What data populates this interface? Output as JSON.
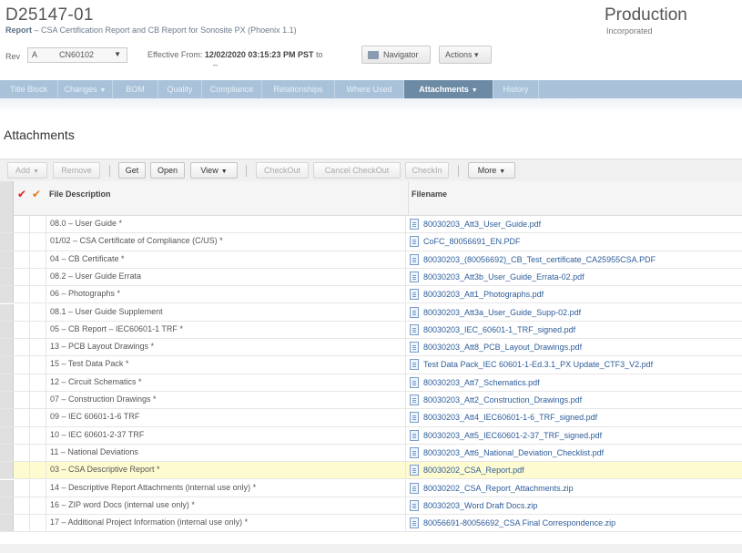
{
  "header": {
    "object_id": "D25147-01",
    "subtitle_label": "Report",
    "subtitle_text": " – CSA Certification Report and CB Report for Sonosite PX (Phoenix 1.1)",
    "lifecycle": "Production",
    "lifecycle_sub": "Incorporated",
    "rev_label": "Rev",
    "rev_value": "A",
    "rev_change": "CN60102",
    "effective_label": "Effective From:",
    "effective_value": "12/02/2020 03:15:23 PM PST",
    "effective_to": "to",
    "effective_dash": "–",
    "navigator_label": "Navigator",
    "actions_label": "Actions ▾"
  },
  "tabs": [
    {
      "label": "Title Block",
      "active": false,
      "dropdown": false
    },
    {
      "label": "Changes",
      "active": false,
      "dropdown": true
    },
    {
      "label": "BOM",
      "active": false,
      "dropdown": false
    },
    {
      "label": "Quality",
      "active": false,
      "dropdown": false
    },
    {
      "label": "Compliance",
      "active": false,
      "dropdown": false
    },
    {
      "label": "Relationships",
      "active": false,
      "dropdown": false
    },
    {
      "label": "Where Used",
      "active": false,
      "dropdown": false
    },
    {
      "label": "Attachments",
      "active": true,
      "dropdown": true
    },
    {
      "label": "History",
      "active": false,
      "dropdown": false
    }
  ],
  "section_title": "Attachments",
  "toolbar": {
    "add": "Add",
    "remove": "Remove",
    "get": "Get",
    "open": "Open",
    "view": "View",
    "checkout": "CheckOut",
    "cancel_checkout": "Cancel CheckOut",
    "checkin": "CheckIn",
    "more": "More"
  },
  "grid": {
    "col_desc": "File Description",
    "col_file": "Filename",
    "rows": [
      {
        "desc": "08.0 – User Guide *",
        "file": "80030203_Att3_User_Guide.pdf"
      },
      {
        "desc": "01/02 – CSA Certificate of Compliance (C/US) *",
        "file": "CoFC_80056691_EN.PDF"
      },
      {
        "desc": "04 – CB Certificate *",
        "file": "80030203_(80056692)_CB_Test_certificate_CA25955CSA.PDF"
      },
      {
        "desc": "08.2 – User Guide Errata",
        "file": "80030203_Att3b_User_Guide_Errata-02.pdf"
      },
      {
        "desc": "06 – Photographs *",
        "file": "80030203_Att1_Photographs.pdf"
      },
      {
        "desc": "08.1 – User Guide Supplement",
        "file": "80030203_Att3a_User_Guide_Supp-02.pdf"
      },
      {
        "desc": "05 – CB Report – IEC60601-1 TRF *",
        "file": "80030203_IEC_60601-1_TRF_signed.pdf"
      },
      {
        "desc": "13 – PCB Layout Drawings *",
        "file": "80030203_Att8_PCB_Layout_Drawings.pdf"
      },
      {
        "desc": "15 – Test Data Pack *",
        "file": "Test Data Pack_IEC 60601-1-Ed.3.1_PX Update_CTF3_V2.pdf"
      },
      {
        "desc": "12 – Circuit Schematics *",
        "file": "80030203_Att7_Schematics.pdf"
      },
      {
        "desc": "07 – Construction Drawings *",
        "file": "80030203_Att2_Construction_Drawings.pdf"
      },
      {
        "desc": "09 – IEC 60601-1-6 TRF",
        "file": "80030203_Att4_IEC60601-1-6_TRF_signed.pdf"
      },
      {
        "desc": "10 – IEC 60601-2-37 TRF",
        "file": "80030203_Att5_IEC60601-2-37_TRF_signed.pdf"
      },
      {
        "desc": "11 – National Deviations",
        "file": "80030203_Att6_National_Deviation_Checklist.pdf"
      },
      {
        "desc": "03 – CSA Descriptive Report *",
        "file": "80030202_CSA_Report.pdf",
        "highlighted": true
      },
      {
        "desc": "14 – Descriptive Report Attachments (internal use only) *",
        "file": "80030202_CSA_Report_Attachments.zip"
      },
      {
        "desc": "16 – ZIP word Docs (internal use only) *",
        "file": "80030203_Word Draft Docs.zip"
      },
      {
        "desc": "17 – Additional Project Information (internal use only) *",
        "file": "80056691-80056692_CSA Final Correspondence.zip"
      }
    ]
  },
  "colors": {
    "tab_bar": "#a9c2da",
    "tab_active": "#6d8aa5",
    "link": "#2d5c9a",
    "highlight_row": "#fffbd0",
    "check_red": "#dd2222",
    "check_orange": "#e07b1f"
  },
  "icons": {
    "header_check_red": "checkmark-icon",
    "header_check_orange": "checkmark-icon",
    "file": "document-icon",
    "navigator": "navigator-icon"
  }
}
